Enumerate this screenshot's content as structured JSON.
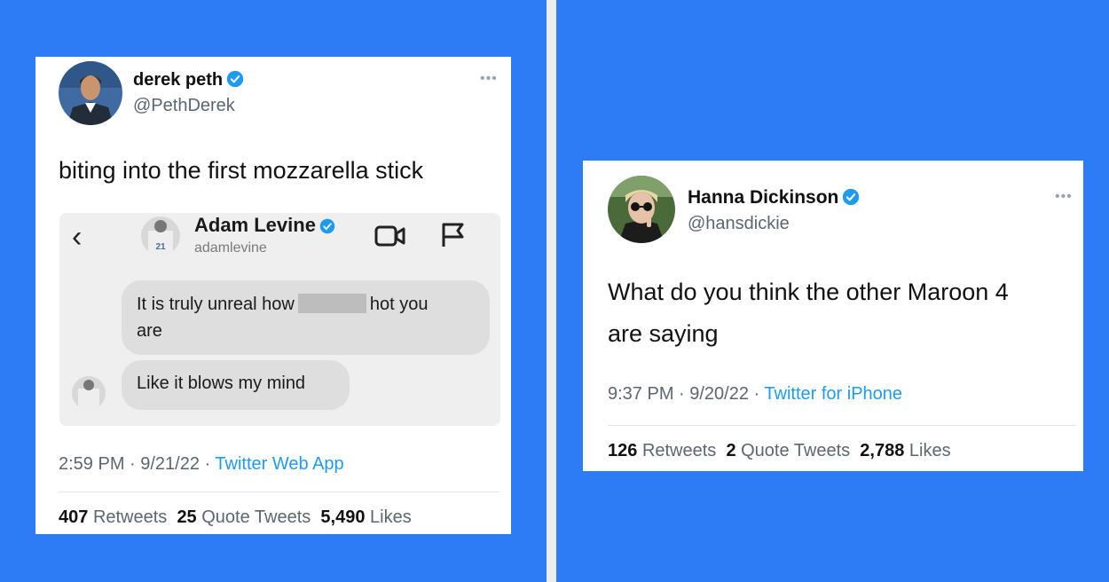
{
  "left_tweet": {
    "name": "derek peth",
    "handle": "@PethDerek",
    "text": "biting into the first mozzarella stick",
    "time": "2:59 PM · 9/21/22 · ",
    "source": "Twitter Web App",
    "retweets": "407",
    "retweets_label": "Retweets",
    "quotes": "25",
    "quotes_label": "Quote Tweets",
    "likes": "5,490",
    "likes_label": "Likes",
    "more_icon": "more-icon",
    "embedded_dm": {
      "name": "Adam Levine",
      "handle": "adamlevine",
      "message_1_part_1": "It is truly unreal how",
      "message_1_part_2": "hot you",
      "message_1_part_3": "are",
      "message_2": "Like it blows my mind",
      "jersey_number": "21"
    }
  },
  "right_tweet": {
    "name": "Hanna Dickinson",
    "handle": "@hansdickie",
    "text_line_1": "What do you think the other Maroon 4",
    "text_line_2": "are saying",
    "time": "9:37 PM · 9/20/22 · ",
    "source": "Twitter for iPhone",
    "retweets": "126",
    "retweets_label": "Retweets",
    "quotes": "2",
    "quotes_label": "Quote Tweets",
    "likes": "2,788",
    "likes_label": "Likes",
    "more_icon": "more-icon"
  },
  "colors": {
    "background": "#2c7cf6",
    "link": "#1d9bf0",
    "verified": "#1d9bf0"
  }
}
